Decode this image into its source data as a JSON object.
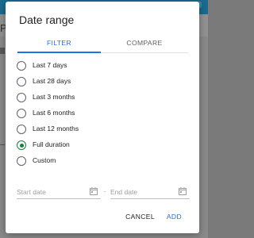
{
  "background": {
    "left_text": "Pe"
  },
  "dialog": {
    "title": "Date range",
    "tabs": [
      {
        "label": "FILTER",
        "active": true
      },
      {
        "label": "COMPARE",
        "active": false
      }
    ],
    "options": [
      {
        "label": "Last 7 days",
        "selected": false
      },
      {
        "label": "Last 28 days",
        "selected": false
      },
      {
        "label": "Last 3 months",
        "selected": false
      },
      {
        "label": "Last 6 months",
        "selected": false
      },
      {
        "label": "Last 12 months",
        "selected": false
      },
      {
        "label": "Full duration",
        "selected": true
      },
      {
        "label": "Custom",
        "selected": false
      }
    ],
    "start_date_placeholder": "Start date",
    "end_date_placeholder": "End date",
    "separator": "-",
    "cancel_label": "CANCEL",
    "add_label": "ADD"
  },
  "colors": {
    "accent": "#1a73e8",
    "radio_selected": "#188038",
    "overlay": "#8a8a8a"
  }
}
